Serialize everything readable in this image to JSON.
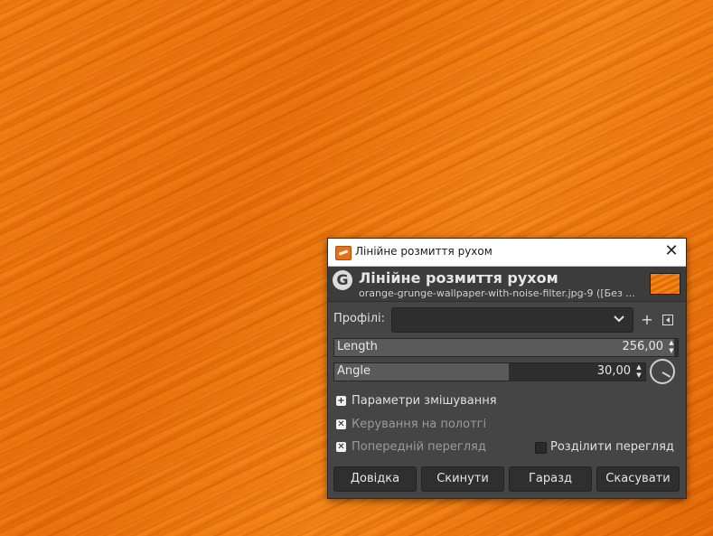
{
  "window": {
    "title": "Лінійне розмиття рухом",
    "close_glyph": "✕"
  },
  "header": {
    "title": "Лінійне розмиття рухом",
    "subtitle": "orange-grunge-wallpaper-with-noise-filter.jpg-9 ([Без ...",
    "logo_letter": "G"
  },
  "profiles": {
    "label": "Профілі:",
    "value": "",
    "add_glyph": "+",
    "menu_glyph": "◂"
  },
  "params": {
    "length": {
      "label": "Length",
      "value": "256,00",
      "fraction": 0.99
    },
    "angle": {
      "label": "Angle",
      "value": "30,00",
      "fraction": 0.56
    }
  },
  "options": {
    "blending_label": "Параметри змішування",
    "canvas_control_label": "Керування на полотгі",
    "preview_label": "Попередній перегляд",
    "split_preview_label": "Розділити перегляд"
  },
  "buttons": {
    "help": "Довідка",
    "reset": "Скинути",
    "ok": "Гаразд",
    "cancel": "Скасувати"
  },
  "colors": {
    "dialog_bg": "#454545",
    "accent": "#ee7a10"
  }
}
